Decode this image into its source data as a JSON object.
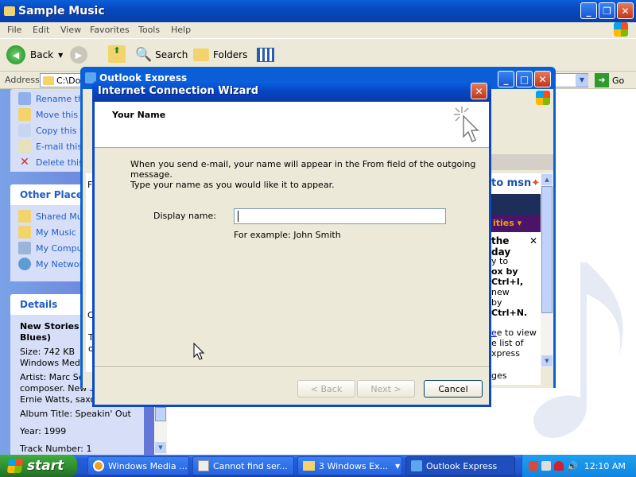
{
  "explorer": {
    "title": "Sample Music",
    "menu": [
      "File",
      "Edit",
      "View",
      "Favorites",
      "Tools",
      "Help"
    ],
    "toolbar": {
      "back": "Back",
      "search": "Search",
      "folders": "Folders"
    },
    "address": {
      "label": "Address",
      "value": "C:\\Do",
      "go": "Go"
    },
    "tasks": [
      "Rename this",
      "Move this f",
      "Copy this f",
      "E-mail this",
      "Delete this"
    ],
    "other_places": {
      "title": "Other Places",
      "items": [
        "Shared Mu",
        "My Music",
        "My Comput",
        "My Networ"
      ]
    },
    "details": {
      "title": "Details",
      "name": "New Stories (",
      "name2": "Blues)",
      "size": "Size: 742 KB",
      "type": "Windows Media",
      "artist": "Artist: Marc Sea",
      "artist2": "composer. New Sto",
      "artist3": "Ernie Watts, saxop",
      "album": "Album Title: Speakin' Out",
      "year": "Year: 1999",
      "track": "Track Number: 1"
    }
  },
  "outlook": {
    "title": "Outlook Express",
    "msn": "to msn",
    "ties": "ities ▾",
    "day": "the day",
    "tips": [
      "y to",
      "ox by",
      "Ctrl+I,",
      "new",
      "by",
      "Ctrl+N.",
      "e to view",
      "e list of",
      "xpress"
    ],
    "ges": "ges",
    "left_f": "F",
    "left_c": "C",
    "left_t": "T",
    "left_o": "o"
  },
  "wizard": {
    "title": "Internet Connection Wizard",
    "heading": "Your Name",
    "instruction1": "When you send e-mail, your name will appear in the From field of the outgoing message.",
    "instruction2": "Type your name as you would like it to appear.",
    "display_label": "Display name:",
    "display_value": "",
    "example": "For example: John Smith",
    "back": "< Back",
    "next": "Next >",
    "cancel": "Cancel"
  },
  "taskbar": {
    "start": "start",
    "tasks": [
      "Windows Media ...",
      "Cannot find ser...",
      "3 Windows Ex...",
      "Outlook Express"
    ],
    "clock": "12:10 AM"
  }
}
